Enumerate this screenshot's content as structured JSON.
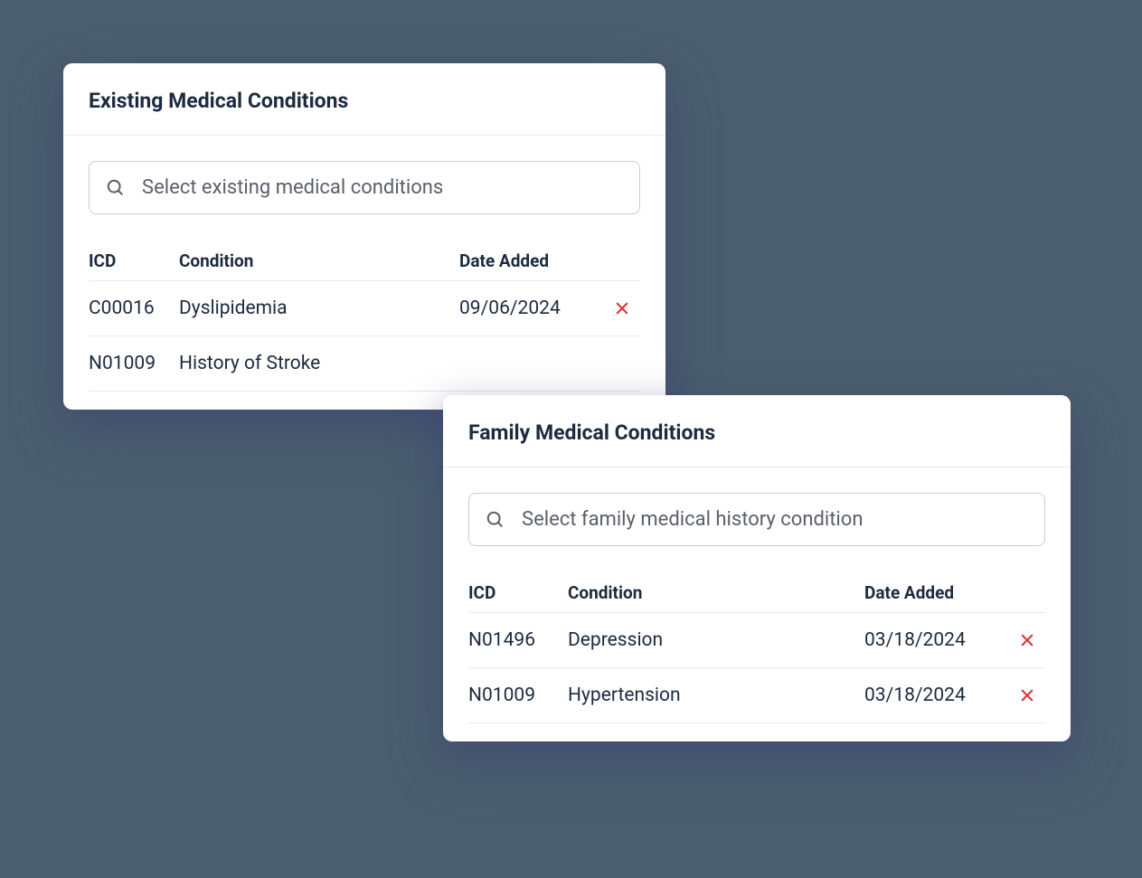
{
  "existing": {
    "title": "Existing Medical Conditions",
    "search_placeholder": "Select existing medical conditions",
    "columns": {
      "icd": "ICD",
      "condition": "Condition",
      "date": "Date Added"
    },
    "rows": [
      {
        "icd": "C00016",
        "condition": "Dyslipidemia",
        "date": "09/06/2024"
      },
      {
        "icd": "N01009",
        "condition": "History of Stroke",
        "date": ""
      }
    ]
  },
  "family": {
    "title": "Family Medical Conditions",
    "search_placeholder": "Select family medical history condition",
    "columns": {
      "icd": "ICD",
      "condition": "Condition",
      "date": "Date Added"
    },
    "rows": [
      {
        "icd": "N01496",
        "condition": "Depression",
        "date": "03/18/2024"
      },
      {
        "icd": "N01009",
        "condition": "Hypertension",
        "date": "03/18/2024"
      }
    ]
  },
  "icons": {
    "search": "search-icon",
    "delete": "close-icon"
  }
}
